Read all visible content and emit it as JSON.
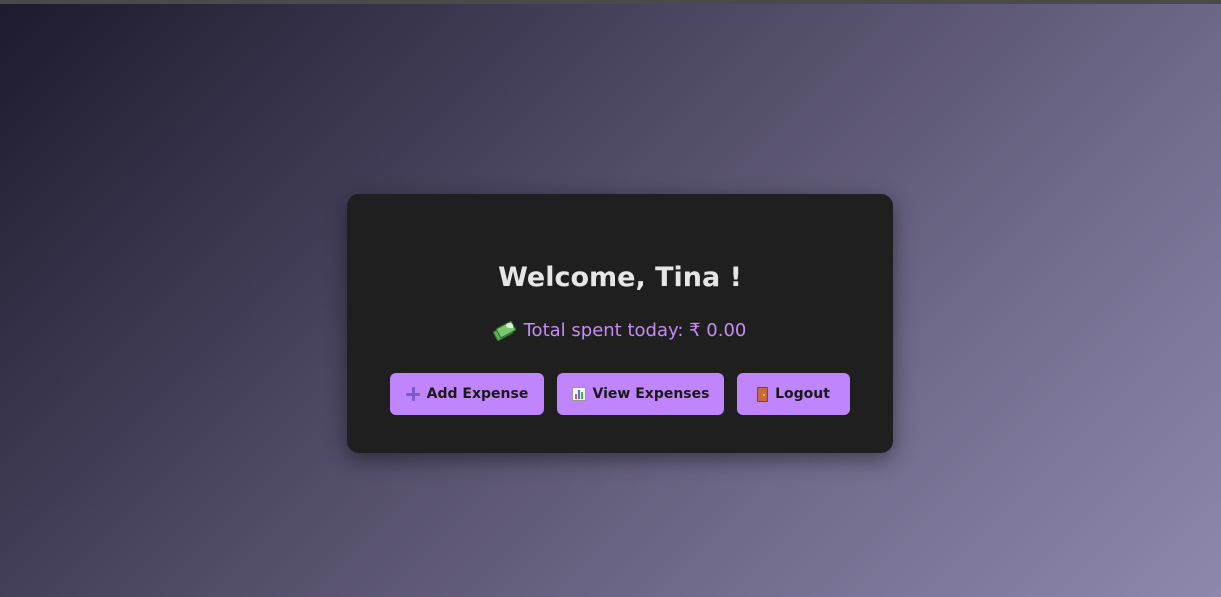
{
  "welcome": {
    "title": "Welcome, Tina !"
  },
  "summary": {
    "icon": "money-with-wings-icon",
    "text": "Total spent today: ₹ 0.00"
  },
  "actions": {
    "add": {
      "icon": "plus-icon",
      "label": "Add Expense"
    },
    "view": {
      "icon": "bar-chart-icon",
      "label": "View Expenses"
    },
    "logout": {
      "icon": "door-icon",
      "label": "Logout"
    }
  },
  "colors": {
    "accent": "#c084fc",
    "card_bg": "#1f1f1f",
    "title_text": "#e6e6e6",
    "summary_text": "#c58cf5"
  }
}
